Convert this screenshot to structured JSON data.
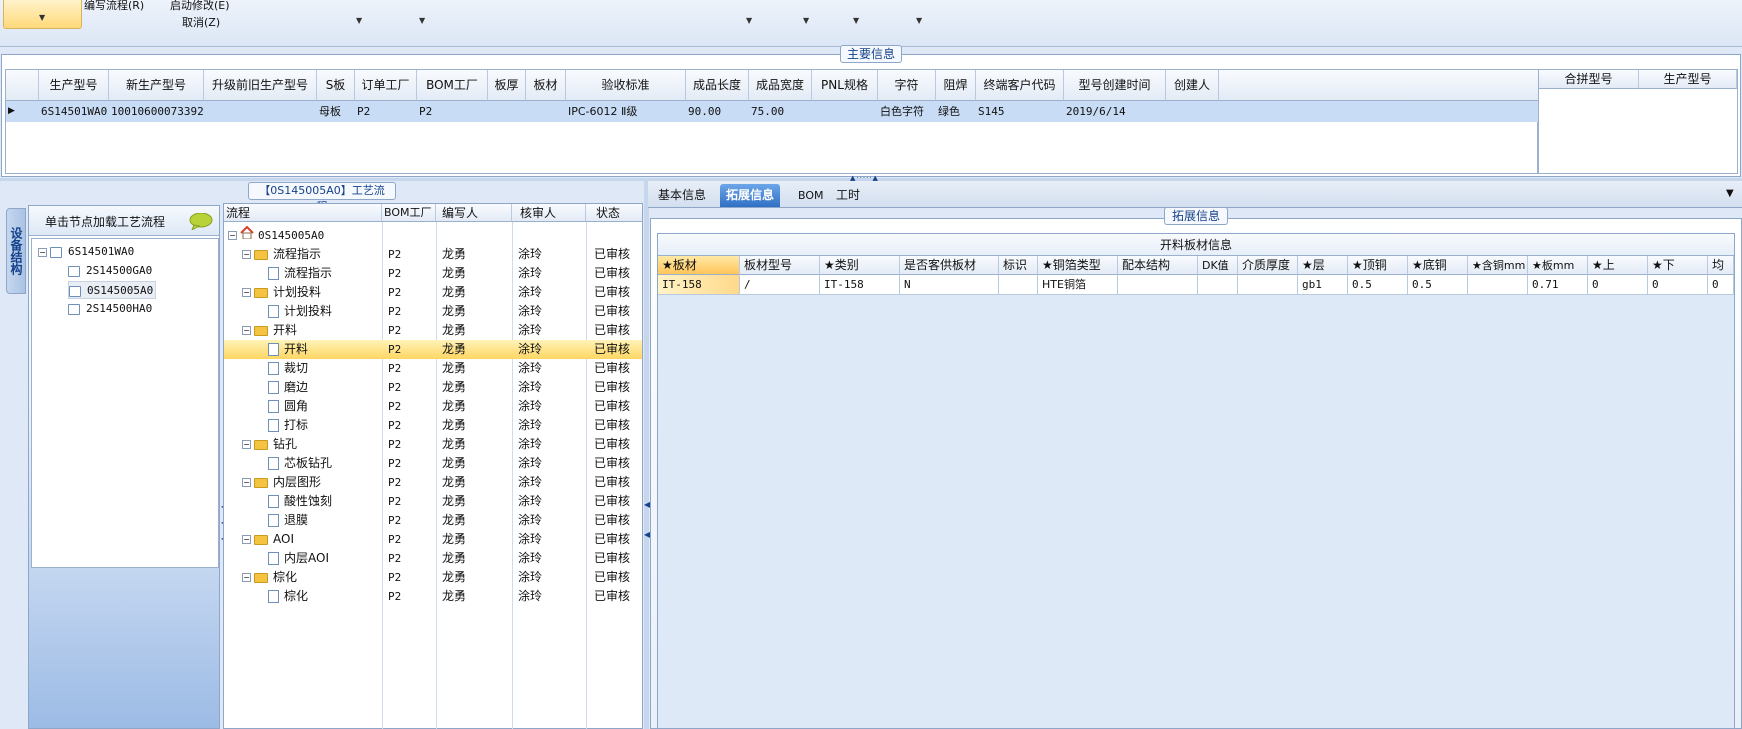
{
  "ribbon": {
    "menu_flow": "编写流程(R)",
    "menu_start_change": "启动修改(E)",
    "menu_cancel": "取消(Z)"
  },
  "main_info": {
    "title": "主要信息",
    "columns": [
      "生产型号",
      "新生产型号",
      "升级前旧生产型号",
      "S板",
      "订单工厂",
      "BOM工厂",
      "板厚",
      "板材",
      "验收标准",
      "成品长度",
      "成品宽度",
      "PNL规格",
      "字符",
      "阻焊",
      "终端客户代码",
      "型号创建时间",
      "创建人"
    ],
    "row": [
      "6S14501WA0",
      "10010600073392",
      "",
      "母板",
      "P2",
      "P2",
      "",
      "",
      "IPC-6012 Ⅱ级",
      "90.00",
      "75.00",
      "",
      "白色字符",
      "绿色",
      "S145",
      "2019/6/14",
      ""
    ],
    "merge_columns": [
      "合拼型号",
      "生产型号"
    ]
  },
  "structure_tab": "设备结构",
  "tree": {
    "hint": "单击节点加载工艺流程",
    "root": "6S14501WA0",
    "children": [
      "2S14500GA0",
      "0S145005A0",
      "2S14500HA0"
    ]
  },
  "flow": {
    "title": "【0S145005A0】工艺流程",
    "columns": [
      "流程",
      "BOM工厂",
      "编写人",
      "核审人",
      "状态"
    ],
    "root": "0S145005A0",
    "rows": [
      {
        "name": "流程指示",
        "kind": "folder",
        "bom": "P2",
        "writer": "龙勇",
        "reviewer": "涂玲",
        "status": "已审核"
      },
      {
        "name": "流程指示",
        "kind": "doc",
        "bom": "P2",
        "writer": "龙勇",
        "reviewer": "涂玲",
        "status": "已审核"
      },
      {
        "name": "计划投料",
        "kind": "folder",
        "bom": "P2",
        "writer": "龙勇",
        "reviewer": "涂玲",
        "status": "已审核"
      },
      {
        "name": "计划投料",
        "kind": "doc",
        "bom": "P2",
        "writer": "龙勇",
        "reviewer": "涂玲",
        "status": "已审核"
      },
      {
        "name": "开料",
        "kind": "folder",
        "bom": "P2",
        "writer": "龙勇",
        "reviewer": "涂玲",
        "status": "已审核"
      },
      {
        "name": "开料",
        "kind": "doc",
        "bom": "P2",
        "writer": "龙勇",
        "reviewer": "涂玲",
        "status": "已审核"
      },
      {
        "name": "裁切",
        "kind": "doc",
        "bom": "P2",
        "writer": "龙勇",
        "reviewer": "涂玲",
        "status": "已审核"
      },
      {
        "name": "磨边",
        "kind": "doc",
        "bom": "P2",
        "writer": "龙勇",
        "reviewer": "涂玲",
        "status": "已审核"
      },
      {
        "name": "圆角",
        "kind": "doc",
        "bom": "P2",
        "writer": "龙勇",
        "reviewer": "涂玲",
        "status": "已审核"
      },
      {
        "name": "打标",
        "kind": "doc",
        "bom": "P2",
        "writer": "龙勇",
        "reviewer": "涂玲",
        "status": "已审核"
      },
      {
        "name": "钻孔",
        "kind": "folder",
        "bom": "P2",
        "writer": "龙勇",
        "reviewer": "涂玲",
        "status": "已审核"
      },
      {
        "name": "芯板钻孔",
        "kind": "doc",
        "bom": "P2",
        "writer": "龙勇",
        "reviewer": "涂玲",
        "status": "已审核"
      },
      {
        "name": "内层图形",
        "kind": "folder",
        "bom": "P2",
        "writer": "龙勇",
        "reviewer": "涂玲",
        "status": "已审核"
      },
      {
        "name": "酸性蚀刻",
        "kind": "doc",
        "bom": "P2",
        "writer": "龙勇",
        "reviewer": "涂玲",
        "status": "已审核"
      },
      {
        "name": "退膜",
        "kind": "doc",
        "bom": "P2",
        "writer": "龙勇",
        "reviewer": "涂玲",
        "status": "已审核"
      },
      {
        "name": "AOI",
        "kind": "folder",
        "bom": "P2",
        "writer": "龙勇",
        "reviewer": "涂玲",
        "status": "已审核"
      },
      {
        "name": "内层AOI",
        "kind": "doc",
        "bom": "P2",
        "writer": "龙勇",
        "reviewer": "涂玲",
        "status": "已审核"
      },
      {
        "name": "棕化",
        "kind": "folder",
        "bom": "P2",
        "writer": "龙勇",
        "reviewer": "涂玲",
        "status": "已审核"
      },
      {
        "name": "棕化",
        "kind": "doc",
        "bom": "P2",
        "writer": "龙勇",
        "reviewer": "涂玲",
        "status": "已审核"
      }
    ]
  },
  "right_tabs": [
    "基本信息",
    "拓展信息",
    "BOM",
    "工时"
  ],
  "ext": {
    "title": "拓展信息",
    "grid_title": "开料板材信息",
    "columns": [
      "★板材",
      "板材型号",
      "★类别",
      "是否客供板材",
      "标识",
      "★铜箔类型",
      "配本结构",
      "DK值",
      "介质厚度",
      "★层",
      "★顶铜",
      "★底铜",
      "★含铜mm",
      "★板mm",
      "★上",
      "★下",
      "均"
    ],
    "row": [
      "IT-158",
      "/",
      "IT-158",
      "N",
      "",
      "HTE铜箔",
      "",
      "",
      "",
      "gb1",
      "0.5",
      "0.5",
      "",
      "0.71",
      "0",
      "0",
      "0"
    ]
  }
}
